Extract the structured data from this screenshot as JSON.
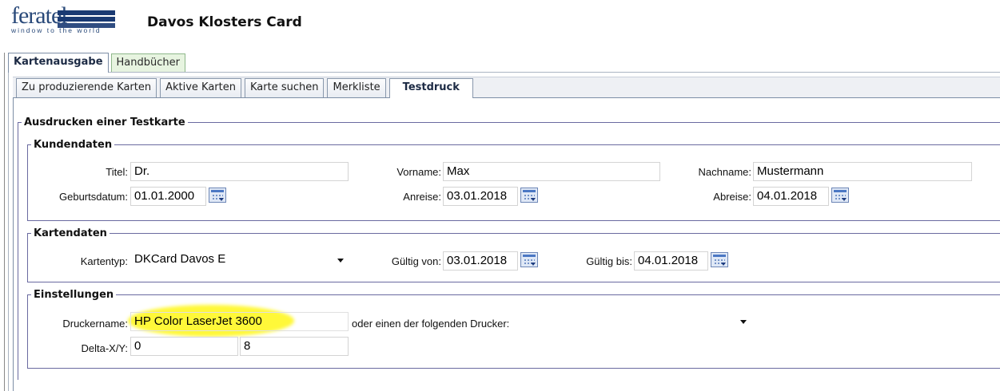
{
  "branding": {
    "logo_word": "feratel",
    "tagline": "window to the world",
    "logo_color": "#1a3a73"
  },
  "app_title": "Davos Klosters Card",
  "main_tabs": [
    {
      "label": "Kartenausgabe",
      "active": true
    },
    {
      "label": "Handbücher",
      "active": false
    }
  ],
  "sub_tabs": [
    {
      "label": "Zu produzierende Karten",
      "active": false
    },
    {
      "label": "Aktive Karten",
      "active": false
    },
    {
      "label": "Karte suchen",
      "active": false
    },
    {
      "label": "Merkliste",
      "active": false
    },
    {
      "label": "Testdruck",
      "active": true
    }
  ],
  "testdruck": {
    "title": "Ausdrucken einer Testkarte",
    "kundendaten": {
      "legend": "Kundendaten",
      "titel_label": "Titel:",
      "titel_value": "Dr.",
      "vorname_label": "Vorname:",
      "vorname_value": "Max",
      "nachname_label": "Nachname:",
      "nachname_value": "Mustermann",
      "geburtsdatum_label": "Geburtsdatum:",
      "geburtsdatum_value": "01.01.2000",
      "anreise_label": "Anreise:",
      "anreise_value": "03.01.2018",
      "abreise_label": "Abreise:",
      "abreise_value": "04.01.2018"
    },
    "kartendaten": {
      "legend": "Kartendaten",
      "kartentyp_label": "Kartentyp:",
      "kartentyp_value": "DKCard Davos E",
      "gueltig_von_label": "Gültig von:",
      "gueltig_von_value": "03.01.2018",
      "gueltig_bis_label": "Gültig bis:",
      "gueltig_bis_value": "04.01.2018"
    },
    "einstellungen": {
      "legend": "Einstellungen",
      "druckername_label": "Druckername:",
      "druckername_value": "HP Color LaserJet 3600",
      "drucker_select_label": "oder einen der folgenden Drucker:",
      "drucker_select_value": "",
      "delta_label": "Delta-X/Y:",
      "delta_x_value": "0",
      "delta_y_value": "8",
      "highlight_color": "#fff728"
    }
  },
  "colors": {
    "fieldset_border": "#6a6aa0",
    "active_tab_text": "#1c2a44",
    "inactive_main_tab_bg": "#e7f4e0",
    "calendar_icon": "#4b78c4"
  }
}
